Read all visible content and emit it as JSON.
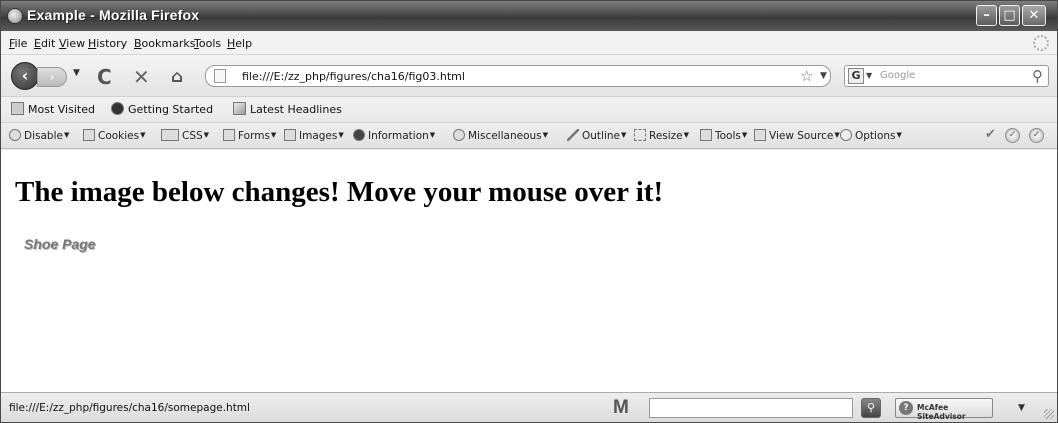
{
  "window": {
    "title": "Example - Mozilla Firefox"
  },
  "menubar": {
    "items": [
      "File",
      "Edit",
      "View",
      "History",
      "Bookmarks",
      "Tools",
      "Help"
    ]
  },
  "navbar": {
    "url": "file:///E:/zz_php/figures/cha16/fig03.html",
    "search_placeholder": "Google",
    "search_engine_letter": "G"
  },
  "bookmarks": {
    "items": [
      "Most Visited",
      "Getting Started",
      "Latest Headlines"
    ]
  },
  "devbar": {
    "items": [
      "Disable",
      "Cookies",
      "CSS",
      "Forms",
      "Images",
      "Information",
      "Miscellaneous",
      "Outline",
      "Resize",
      "Tools",
      "View Source",
      "Options"
    ]
  },
  "content": {
    "heading": "The image below changes! Move your mouse over it!",
    "link_text": "Shoe Page"
  },
  "statusbar": {
    "status_text": "file:///E:/zz_php/figures/cha16/somepage.html",
    "m_label": "M",
    "siteadvisor_text": "McAfee SiteAdvisor"
  }
}
